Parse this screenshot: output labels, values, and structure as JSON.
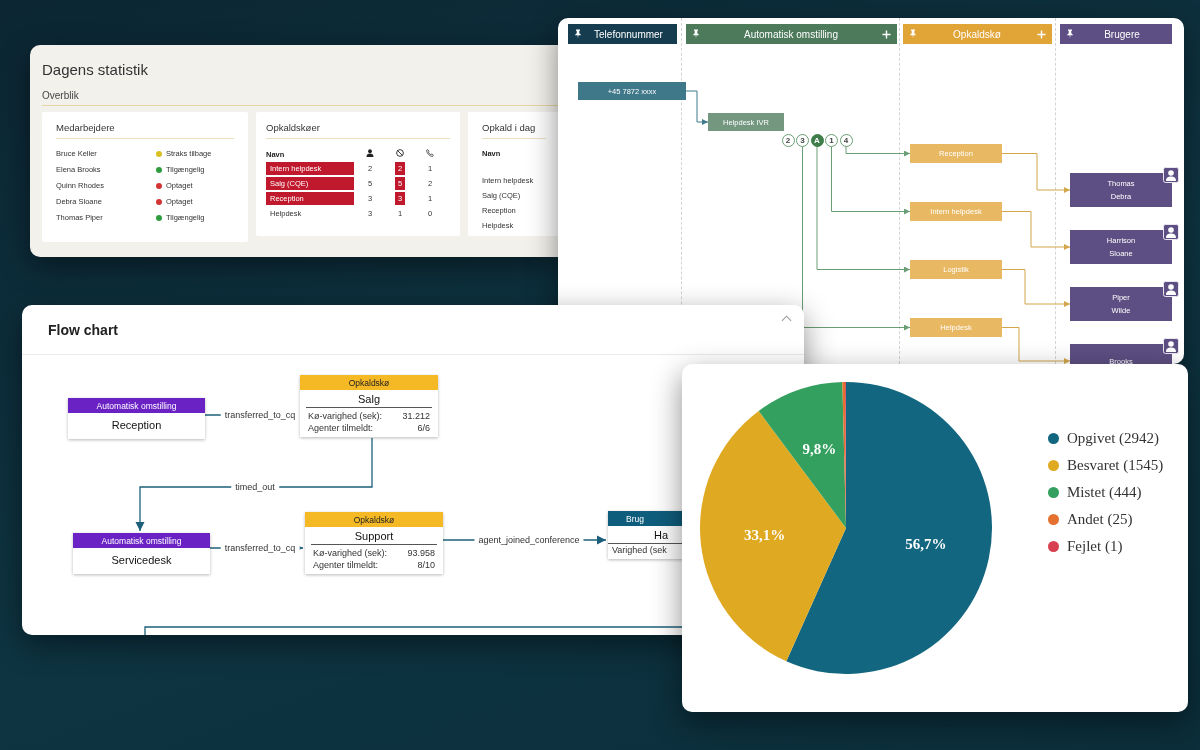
{
  "stats_panel": {
    "title": "Dagens statistik",
    "section": "Overblik",
    "employees": {
      "title": "Medarbejdere",
      "rows": [
        {
          "name": "Bruce Keller",
          "status": "Straks tilbage",
          "color": "#d8c021"
        },
        {
          "name": "Elena Brooks",
          "status": "Tilgængelig",
          "color": "#2e9b3f"
        },
        {
          "name": "Quinn Rhodes",
          "status": "Optaget",
          "color": "#d33333"
        },
        {
          "name": "Debra Sloane",
          "status": "Optaget",
          "color": "#d33333"
        },
        {
          "name": "Thomas Piper",
          "status": "Tilgængelig",
          "color": "#2e9b3f"
        }
      ]
    },
    "queues": {
      "title": "Opkaldskøer",
      "name_heading": "Navn",
      "rows": [
        {
          "name": "Intern helpdesk",
          "alert": true,
          "counts": [
            "2",
            "2",
            "1"
          ]
        },
        {
          "name": "Salg (CQE)",
          "alert": true,
          "counts": [
            "5",
            "5",
            "2"
          ]
        },
        {
          "name": "Reception",
          "alert": true,
          "counts": [
            "3",
            "3",
            "1"
          ]
        },
        {
          "name": "Helpdesk",
          "alert": false,
          "counts": [
            "3",
            "1",
            "0"
          ]
        }
      ]
    },
    "calls_today": {
      "title": "Opkald i dag",
      "name_heading": "Navn",
      "rows": [
        "Intern helpdesk",
        "Salg (CQE)",
        "Reception",
        "Helpdesk"
      ]
    }
  },
  "call_flow": {
    "lanes": [
      {
        "kind": "number",
        "title": "Telefonnummer",
        "color": "#163d4f",
        "can_add": false,
        "nodes": [
          {
            "label": "+45 7872 xxxx"
          }
        ]
      },
      {
        "kind": "menu",
        "title": "Automatisk omstilling",
        "color": "#4c7a5b",
        "can_add": true,
        "nodes": [
          {
            "label": "Helpdesk IVR",
            "options": [
              {
                "label": "2",
                "selected": false
              },
              {
                "label": "3",
                "selected": false
              },
              {
                "label": "A",
                "selected": true
              },
              {
                "label": "1",
                "selected": false
              },
              {
                "label": "4",
                "selected": false
              }
            ]
          }
        ]
      },
      {
        "kind": "queue",
        "title": "Opkaldskø",
        "color": "#e1a436",
        "can_add": true,
        "nodes": [
          {
            "label": "Reception"
          },
          {
            "label": "Intern helpdesk"
          },
          {
            "label": "Logistik"
          },
          {
            "label": "Helpdesk"
          }
        ]
      },
      {
        "kind": "user",
        "title": "Brugere",
        "color": "#5d4f83",
        "can_add": false,
        "nodes": [
          {
            "lines": [
              "Thomas",
              "Debra"
            ]
          },
          {
            "lines": [
              "Harrison",
              "Sloane"
            ]
          },
          {
            "lines": [
              "Piper",
              "Wilde"
            ]
          },
          {
            "lines": [
              "Brooks"
            ]
          }
        ]
      }
    ]
  },
  "flow_chart": {
    "title": "Flow chart",
    "nodes": [
      {
        "kind": "auto",
        "type_label": "Automatisk omstilling",
        "name": "Reception"
      },
      {
        "kind": "queue",
        "type_label": "Opkaldskø",
        "name": "Salg",
        "stats": [
          {
            "label": "Kø-varighed (sek):",
            "value": "31.212"
          },
          {
            "label": "Agenter tilmeldt:",
            "value": "6/6"
          }
        ]
      },
      {
        "kind": "auto",
        "type_label": "Automatisk omstilling",
        "name": "Servicedesk"
      },
      {
        "kind": "queue",
        "type_label": "Opkaldskø",
        "name": "Support",
        "stats": [
          {
            "label": "Kø-varighed (sek):",
            "value": "93.958"
          },
          {
            "label": "Agenter tilmeldt:",
            "value": "8/10"
          }
        ]
      },
      {
        "kind": "user",
        "type_label": "Brug",
        "name": "Ha",
        "stats": [
          {
            "label": "Varighed (sek"
          }
        ]
      }
    ],
    "edges": [
      {
        "label": "transferred_to_cq"
      },
      {
        "label": "timed_out"
      },
      {
        "label": "transferred_to_cq"
      },
      {
        "label": "agent_joined_conference"
      }
    ]
  },
  "outcome_chart": {
    "chart_data": {
      "type": "pie",
      "categories": [
        "Opgivet (2942)",
        "Besvaret (1545)",
        "Mistet (444)",
        "Andet (25)",
        "Fejlet (1)"
      ],
      "values": [
        56.7,
        33.1,
        9.8,
        0.3,
        0.1
      ],
      "colors": [
        "#12667f",
        "#e0a922",
        "#34a05f",
        "#e4712f",
        "#d9404f"
      ],
      "value_labels": [
        "56,7%",
        "33,1%",
        "9,8%",
        null,
        null
      ]
    }
  }
}
